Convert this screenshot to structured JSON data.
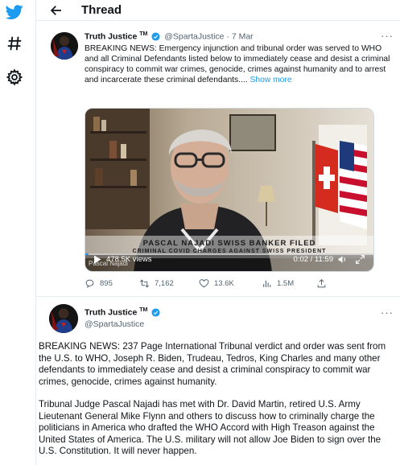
{
  "nav": {
    "icons": [
      "twitter-bird-icon",
      "hashtag-icon",
      "gear-icon"
    ]
  },
  "header": {
    "title": "Thread"
  },
  "tweet1": {
    "name": "Truth Justice",
    "tm": "TM",
    "handle_time": "@SpartaJustice · 7 Mar",
    "text": "BREAKING NEWS: Emergency injunction and tribunal order was served to WHO and all Criminal Defendants listed below to immediately cease and desist a criminal conspiracy to commit war crimes, genocide, crimes against humanity and to arrest and incarcerate these criminal defendants.... ",
    "show_more": "Show more",
    "video": {
      "caption_line1": "PASCAL NAJADI SWISS BANKER FILED",
      "caption_line2": "CRIMINAL COVID CHARGES AGAINST SWISS PRESIDENT",
      "nameplate": "Pascal Najadi",
      "views": "478.5K views",
      "time": "0:02 / 11:59"
    },
    "stats": {
      "replies": "895",
      "retweets": "7,162",
      "likes": "13.6K",
      "views": "1.5M"
    }
  },
  "tweet2": {
    "name": "Truth Justice",
    "tm": "TM",
    "handle": "@SpartaJustice",
    "paragraph1": "BREAKING NEWS: 237 Page International Tribunal verdict and order was sent from the U.S. to WHO, Joseph R. Biden, Trudeau, Tedros, King Charles and many other defendants to immediately cease and desist a criminal conspiracy to commit war crimes, genocide, crimes against humanity.",
    "paragraph2": "Tribunal Judge Pascal Najadi has met with Dr. David Martin, retired U.S. Army Lieutenant General Mike Flynn and others to discuss how to criminally charge the politicians in America who drafted the WHO Accord with High Treason against the United States of America. The U.S. military will not allow Joe Biden to sign over the U.S. Constitution. It will never happen."
  },
  "colors": {
    "accent": "#1d9bf0",
    "muted": "#536471",
    "border": "#e6ecf0"
  }
}
